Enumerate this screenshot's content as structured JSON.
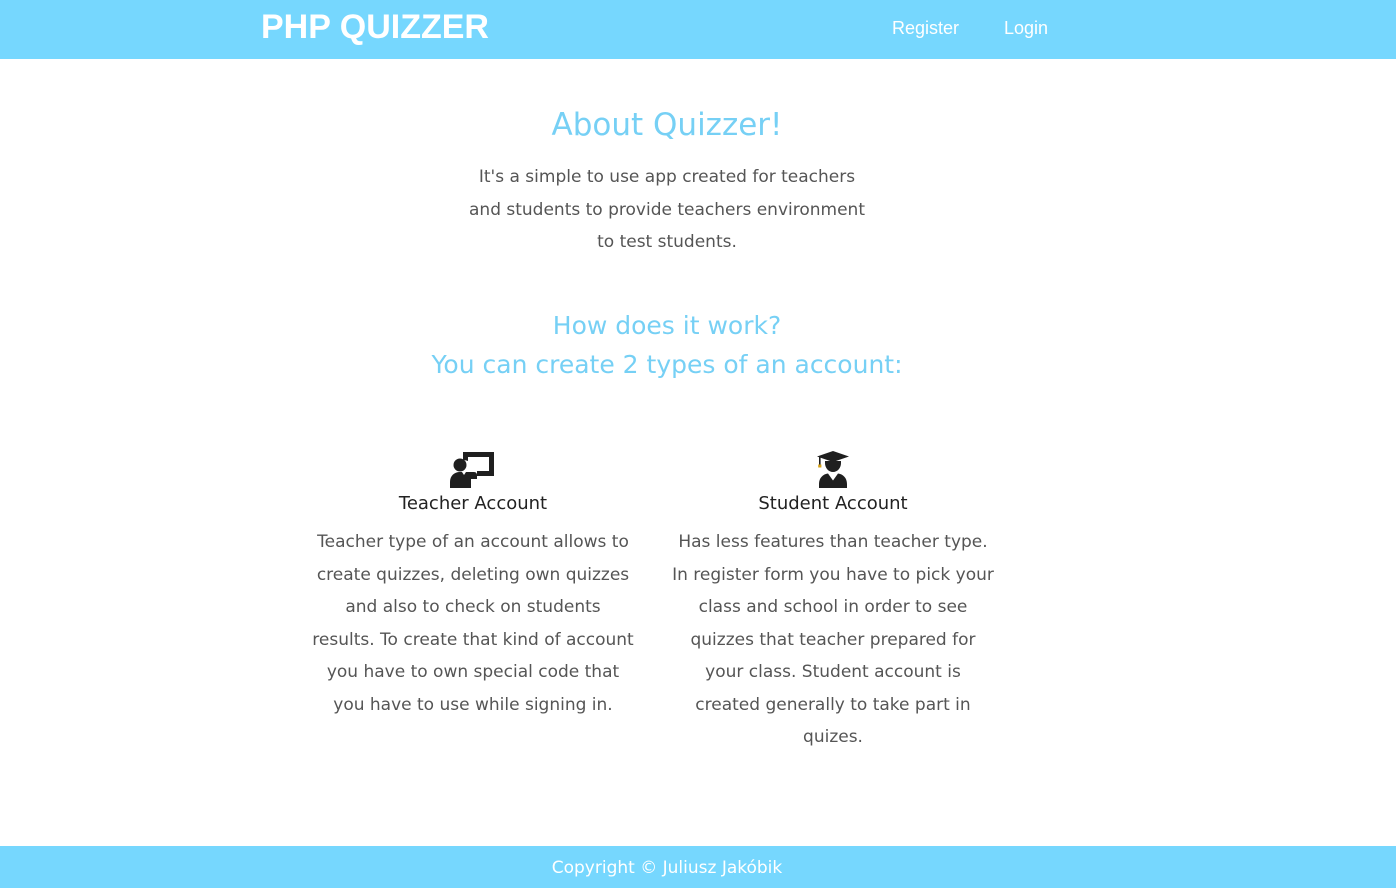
{
  "navbar": {
    "brand": "PHP QUIZZER",
    "links": [
      {
        "label": "Register"
      },
      {
        "label": "Login"
      }
    ]
  },
  "about": {
    "title": "About Quizzer!",
    "text": "It's a simple to use app created for teachers and students to provide teachers environment to test students."
  },
  "how": {
    "line1": "How does it work?",
    "line2": "You can create 2 types of an account:"
  },
  "accounts": [
    {
      "icon": "teacher-board-icon",
      "title": "Teacher Account",
      "text": "Teacher type of an account allows to create quizzes, deleting own quizzes and also to check on students results. To create that kind of account you have to own special code that you have to use while signing in."
    },
    {
      "icon": "graduate-cap-icon",
      "title": "Student Account",
      "text": "Has less features than teacher type. In register form you have to pick your class and school in order to see quizzes that teacher prepared for your class. Student account is created generally to take part in quizes."
    }
  ],
  "footer": {
    "text": "Copyright © Juliusz Jakóbik"
  },
  "colors": {
    "accent": "#76d7fe",
    "heading": "#76d0f5",
    "body_text": "#555555",
    "icon": "#1f1f1f"
  }
}
